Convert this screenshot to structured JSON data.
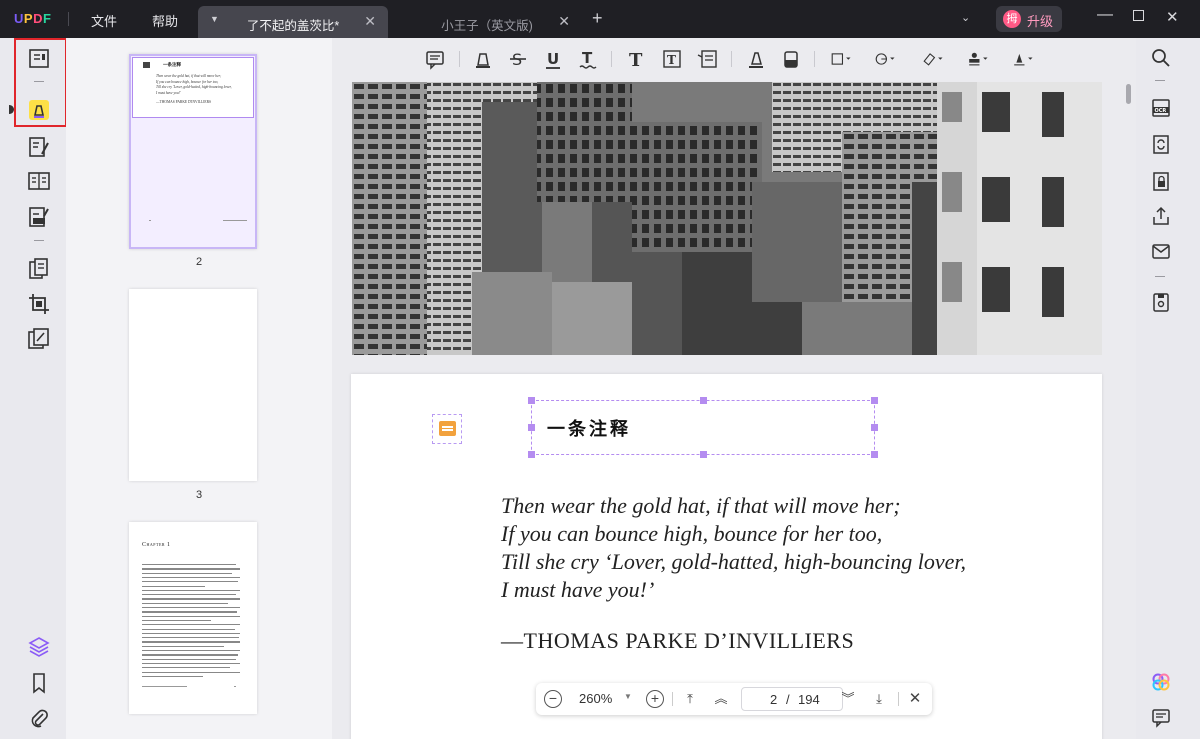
{
  "app": {
    "logo": "UPDF"
  },
  "menu": {
    "file": "文件",
    "help": "帮助"
  },
  "tabs": [
    {
      "label": "了不起的盖茨比*",
      "active": true
    },
    {
      "label": "小王子（英文版)",
      "active": false
    }
  ],
  "account": {
    "avatar_char": "拇",
    "upgrade_label": "升级"
  },
  "thumbnails": [
    {
      "page_label": "2",
      "selected": true,
      "note_title": "一条注释",
      "lines": [
        "Then wear the gold hat, if that will move her;",
        "If you can bounce high, bounce for her too,",
        "Till she cry 'Lover, gold-hatted, high-bouncing lover,",
        "I must have you!'"
      ],
      "author": "—THOMAS PARKE D'INVILLIERS"
    },
    {
      "page_label": "3",
      "selected": false
    },
    {
      "page_label": "",
      "selected": false,
      "heading": "Chapter 1"
    }
  ],
  "document": {
    "note_text": "一条注释",
    "poem_lines": [
      "Then wear the gold hat, if that will move her;",
      "If you can bounce high, bounce for her too,",
      "Till she cry ‘Lover, gold-hatted, high-bouncing lover,",
      "I must have you!’"
    ],
    "author": "—THOMAS PARKE D’INVILLIERS"
  },
  "navigation": {
    "zoom": "260%",
    "current_page": "2",
    "separator": "/",
    "total_pages": "194"
  },
  "colors": {
    "accent": "#8b5cf6",
    "highlight_box": "#e0262b",
    "note": "#f2a23d"
  },
  "icons": {
    "left": [
      "reader-icon",
      "comment-icon",
      "edit-pdf-icon",
      "form-icon",
      "fill-sign-icon",
      "organize-pages-icon",
      "crop-icon",
      "watermark-icon",
      "layers-icon",
      "bookmark-icon",
      "attachment-icon"
    ],
    "toolbar": [
      "sticky-note-icon",
      "highlight-icon",
      "strikethrough-icon",
      "underline-icon",
      "squiggly-icon",
      "text-icon",
      "text-box-icon",
      "text-callout-icon",
      "pencil-icon",
      "eraser-icon",
      "shape-icon",
      "sticker-icon",
      "measure-icon",
      "stamp-icon",
      "signature-icon"
    ],
    "right": [
      "search-icon",
      "ocr-icon",
      "convert-icon",
      "protect-icon",
      "share-icon",
      "email-icon",
      "save-icon",
      "ai-icon",
      "chat-icon"
    ]
  }
}
